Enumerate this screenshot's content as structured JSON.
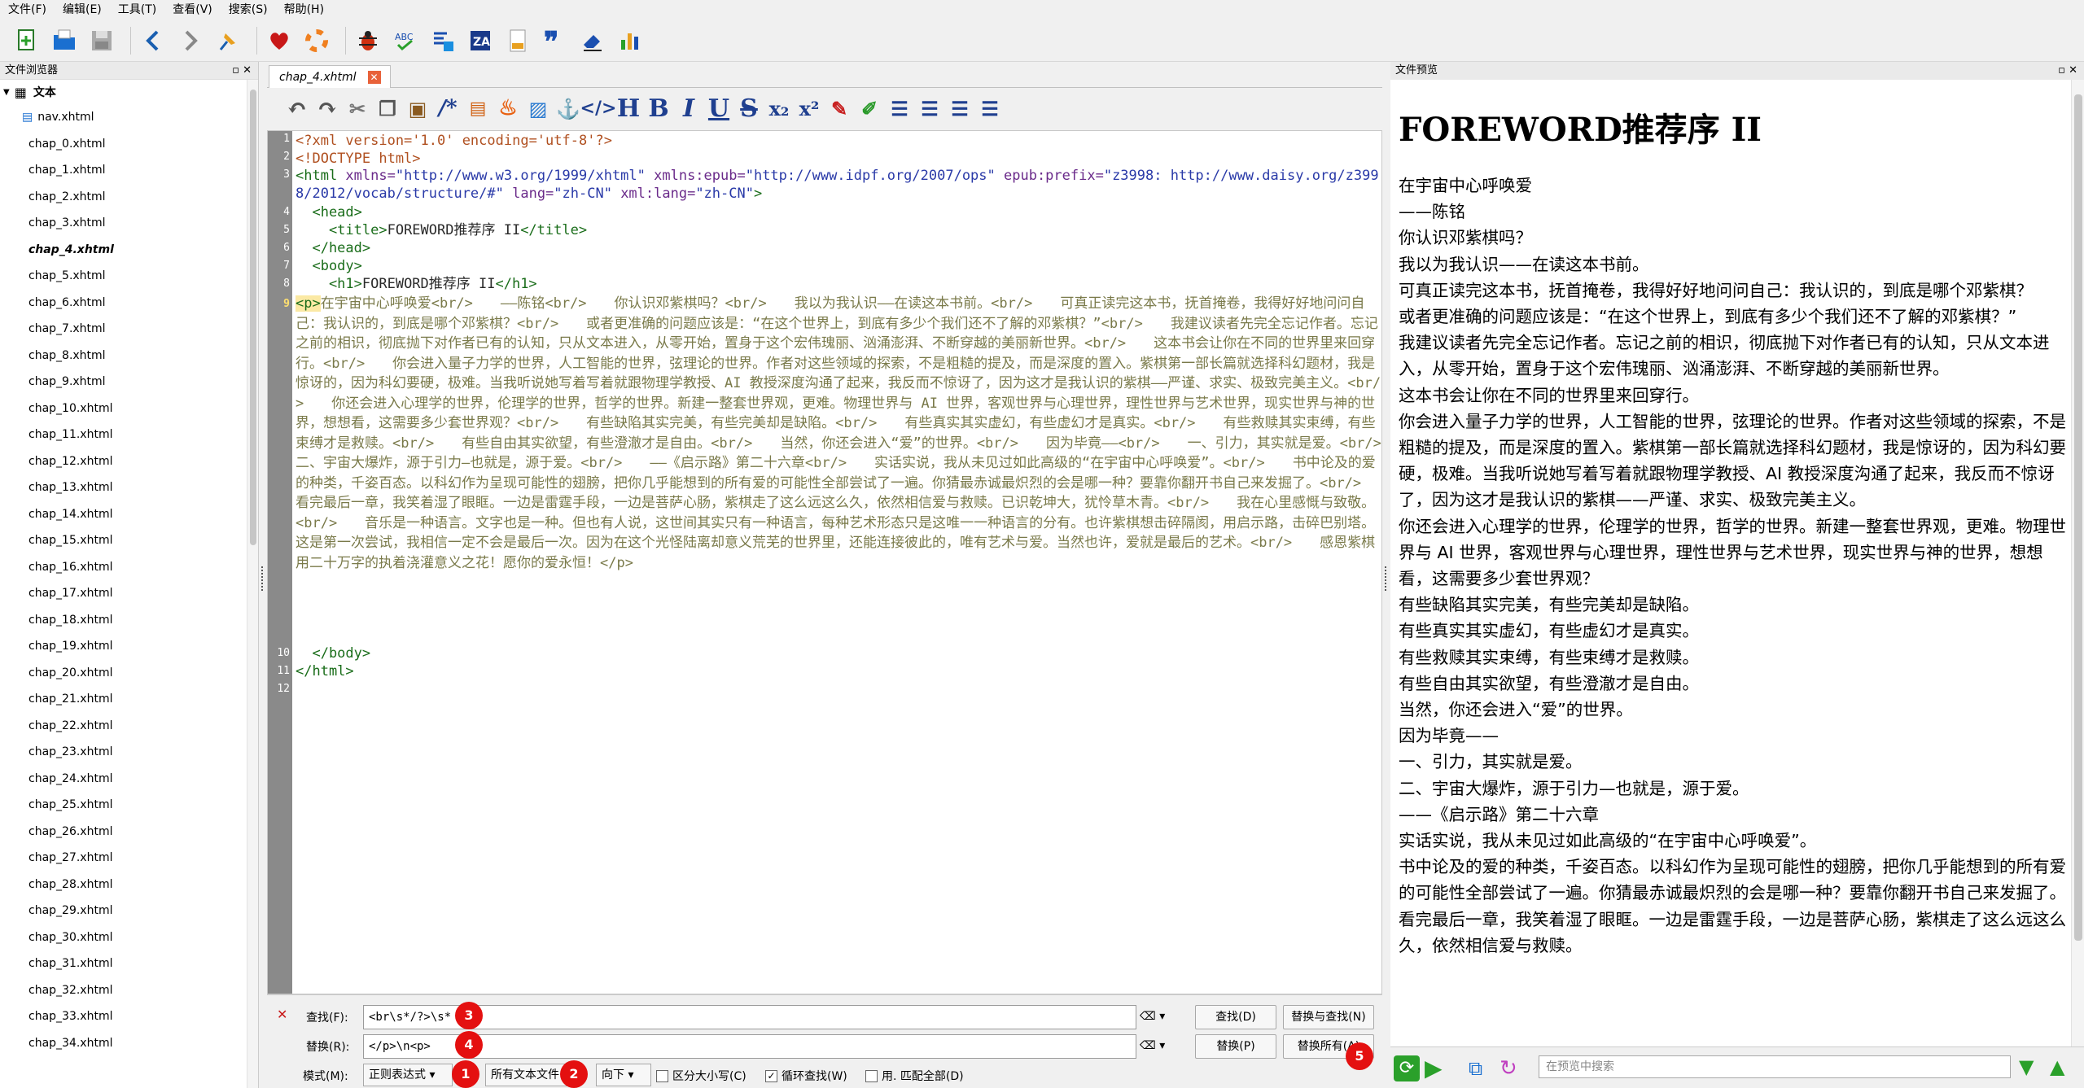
{
  "menu": [
    "文件(F)",
    "编辑(E)",
    "工具(T)",
    "查看(V)",
    "搜索(S)",
    "帮助(H)"
  ],
  "browser": {
    "title": "文件浏览器",
    "root": "文本",
    "nav": "nav.xhtml",
    "files": [
      "chap_0.xhtml",
      "chap_1.xhtml",
      "chap_2.xhtml",
      "chap_3.xhtml",
      "chap_4.xhtml",
      "chap_5.xhtml",
      "chap_6.xhtml",
      "chap_7.xhtml",
      "chap_8.xhtml",
      "chap_9.xhtml",
      "chap_10.xhtml",
      "chap_11.xhtml",
      "chap_12.xhtml",
      "chap_13.xhtml",
      "chap_14.xhtml",
      "chap_15.xhtml",
      "chap_16.xhtml",
      "chap_17.xhtml",
      "chap_18.xhtml",
      "chap_19.xhtml",
      "chap_20.xhtml",
      "chap_21.xhtml",
      "chap_22.xhtml",
      "chap_23.xhtml",
      "chap_24.xhtml",
      "chap_25.xhtml",
      "chap_26.xhtml",
      "chap_27.xhtml",
      "chap_28.xhtml",
      "chap_29.xhtml",
      "chap_30.xhtml",
      "chap_31.xhtml",
      "chap_32.xhtml",
      "chap_33.xhtml",
      "chap_34.xhtml"
    ],
    "active": "chap_4.xhtml"
  },
  "editor": {
    "tab": "chap_4.xhtml",
    "gutter": [
      "1",
      "2",
      "3",
      "4",
      "5",
      "6",
      "7",
      "8",
      "9",
      "10",
      "11",
      "12"
    ],
    "line1": "<?xml version='1.0' encoding='utf-8'?>",
    "line2": "<!DOCTYPE html>",
    "line3a": "<html",
    "line3b": " xmlns=",
    "line3c": "\"http://www.w3.org/1999/xhtml\"",
    "line3d": " xmlns:epub=",
    "line3e": "\"http://www.idpf.org/2007/ops\"",
    "line3f": " epub:prefix=",
    "line3g": "\"z3998: http://www.daisy.org/z3998/2012/vocab/structure/#\"",
    "line3h": " lang=",
    "line3i": "\"zh-CN\"",
    "line3j": " xml:lang=",
    "line3k": "\"zh-CN\"",
    "line3l": ">",
    "line4": "  <head>",
    "line5a": "    <title>",
    "line5b": "FOREWORD推荐序 II",
    "line5c": "</title>",
    "line6": "  </head>",
    "line7": "  <body>",
    "line8a": "    <h1>",
    "line8b": "FOREWORD推荐序 II",
    "line8c": "</h1>",
    "line9_head": "    <p>",
    "line9_body": "在宇宙中心呼唤爱<br/>　　——陈铭<br/>　　你认识邓紫棋吗？<br/>　　我以为我认识——在读这本书前。<br/>　　可真正读完这本书，抚首掩卷，我得好好地问问自己：我认识的，到底是哪个邓紫棋？<br/>　　或者更准确的问题应该是：“在这个世界上，到底有多少个我们还不了解的邓紫棋？”<br/>　　我建议读者先完全忘记作者。忘记之前的相识，彻底抛下对作者已有的认知，只从文本进入，从零开始，置身于这个宏伟瑰丽、汹涌澎湃、不断穿越的美丽新世界。<br/>　　这本书会让你在不同的世界里来回穿行。<br/>　　你会进入量子力学的世界，人工智能的世界，弦理论的世界。作者对这些领域的探索，不是粗糙的提及，而是深度的置入。紫棋第一部长篇就选择科幻题材，我是惊讶的，因为科幻要硬，极难。当我听说她写着写着就跟物理学教授、AI 教授深度沟通了起来，我反而不惊讶了，因为这才是我认识的紫棋——严谨、求实、极致完美主义。<br/>　　你还会进入心理学的世界，伦理学的世界，哲学的世界。新建一整套世界观，更难。物理世界与 AI 世界，客观世界与心理世界，理性世界与艺术世界，现实世界与神的世界，想想看，这需要多少套世界观？<br/>　　有些缺陷其实完美，有些完美却是缺陷。<br/>　　有些真实其实虚幻，有些虚幻才是真实。<br/>　　有些救赎其实束缚，有些束缚才是救赎。<br/>　　有些自由其实欲望，有些澄澈才是自由。<br/>　　当然，你还会进入“爱”的世界。<br/>　　因为毕竟——<br/>　　一、引力，其实就是爱。<br/>　　二、宇宙大爆炸，源于引力—也就是，源于爱。<br/>　　——《启示路》第二十六章<br/>　　实话实说，我从未见过如此高级的“在宇宙中心呼唤爱”。<br/>　　书中论及的爱的种类，千姿百态。以科幻作为呈现可能性的翅膀，把你几乎能想到的所有爱的可能性全部尝试了一遍。你猜最赤诚最炽烈的会是哪一种？要靠你翻开书自己来发掘了。<br/>　　看完最后一章，我笑着湿了眼眶。一边是雷霆手段，一边是菩萨心肠，紫棋走了这么远这么久，依然相信爱与救赎。已识乾坤大，犹怜草木青。<br/>　　我在心里感慨与致敬。<br/>　　音乐是一种语言。文字也是一种。但也有人说，这世间其实只有一种语言，每种艺术形态只是这唯一一种语言的分有。也许紫棋想击碎隔阂，用启示路，击碎巴别塔。这是第一次尝试，我相信一定不会是最后一次。因为在这个光怪陆离却意义荒芜的世界里，还能连接彼此的，唯有艺术与爱。当然也许，爱就是最后的艺术。<br/>　　感恩紫棋用二十万字的执着浇灌意义之花！愿你的爱永恒！</p>",
    "line10": "  </body>",
    "line11": "</html>"
  },
  "find": {
    "find_label": "查找(F):",
    "find_value": "<br\\s*/?>\\s*",
    "replace_label": "替换(R):",
    "replace_value": "</p>\\n<p>",
    "mode_label": "模式(M):",
    "mode_value": "正则表达式",
    "scope_value": "所有文本文件",
    "direction_value": "向下",
    "case_label": "区分大小写(C)",
    "wrap_label": "循环查找(W)",
    "whole_label": "用. 匹配全部(D)",
    "btn_find": "查找(D)",
    "btn_replace_find": "替换与查找(N)",
    "btn_replace": "替换(P)",
    "btn_replace_all": "替换所有(A)",
    "badges": [
      "1",
      "2",
      "3",
      "4",
      "5"
    ]
  },
  "preview": {
    "title": "文件预览",
    "h1": "FOREWORD推荐序 II",
    "paragraphs": [
      "在宇宙中心呼唤爱",
      "——陈铭",
      "你认识邓紫棋吗？",
      "我以为我认识——在读这本书前。",
      "可真正读完这本书，抚首掩卷，我得好好地问问自己：我认识的，到底是哪个邓紫棋？",
      "或者更准确的问题应该是：“在这个世界上，到底有多少个我们还不了解的邓紫棋？”",
      "我建议读者先完全忘记作者。忘记之前的相识，彻底抛下对作者已有的认知，只从文本进入，从零开始，置身于这个宏伟瑰丽、汹涌澎湃、不断穿越的美丽新世界。",
      "这本书会让你在不同的世界里来回穿行。",
      "你会进入量子力学的世界，人工智能的世界，弦理论的世界。作者对这些领域的探索，不是粗糙的提及，而是深度的置入。紫棋第一部长篇就选择科幻题材，我是惊讶的，因为科幻要硬，极难。当我听说她写着写着就跟物理学教授、AI 教授深度沟通了起来，我反而不惊讶了，因为这才是我认识的紫棋——严谨、求实、极致完美主义。",
      "你还会进入心理学的世界，伦理学的世界，哲学的世界。新建一整套世界观，更难。物理世界与 AI 世界，客观世界与心理世界，理性世界与艺术世界，现实世界与神的世界，想想看，这需要多少套世界观？",
      "有些缺陷其实完美，有些完美却是缺陷。",
      "有些真实其实虚幻，有些虚幻才是真实。",
      "有些救赎其实束缚，有些束缚才是救赎。",
      "有些自由其实欲望，有些澄澈才是自由。",
      "当然，你还会进入“爱”的世界。",
      "因为毕竟——",
      "一、引力，其实就是爱。",
      "二、宇宙大爆炸，源于引力—也就是，源于爱。",
      "——《启示路》第二十六章",
      "实话实说，我从未见过如此高级的“在宇宙中心呼唤爱”。",
      "书中论及的爱的种类，千姿百态。以科幻作为呈现可能性的翅膀，把你几乎能想到的所有爱的可能性全部尝试了一遍。你猜最赤诚最炽烈的会是哪一种？要靠你翻开书自己来发掘了。",
      "看完最后一章，我笑着湿了眼眶。一边是雷霆手段，一边是菩萨心肠，紫棋走了这么远这么久，依然相信爱与救赎。"
    ],
    "search_placeholder": "在预览中搜索"
  }
}
